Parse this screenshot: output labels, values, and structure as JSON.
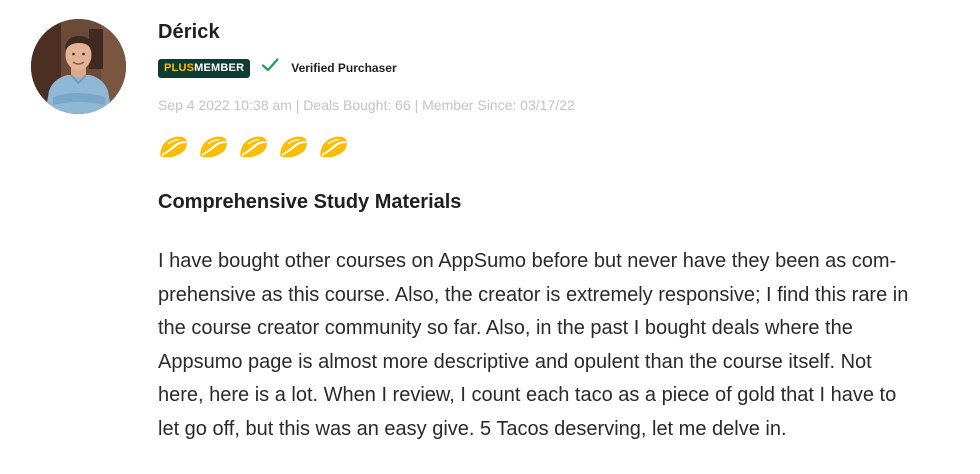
{
  "reviewer": {
    "name": "Dérick",
    "badge_plus": "PLUS",
    "badge_member": "MEMBER",
    "verified_label": "Verified Purchaser",
    "meta": "Sep 4 2022 10:38 am | Deals Bought: 66 | Member Since: 03/17/22",
    "avatar_icon": "person-photo-icon"
  },
  "rating": {
    "value": 5,
    "max": 5,
    "icon": "taco-icon",
    "color": "#ffbc00"
  },
  "review": {
    "title": "Comprehensive Study Materials",
    "body_lines": [
      "I have bought other courses on AppSumo before but never have they been as com-",
      "prehensive as this course. Also, the creator is extremely responsive; I find this rare in",
      "the course creator community so far. Also, in the past I bought deals where the",
      "Appsumo page is almost more descriptive and opulent than the course itself. Not",
      "here, here is a lot. When I review, I count each taco as a piece of gold that I have to",
      "let go off, but this was an easy give. 5 Tacos deserving, let me delve in."
    ]
  },
  "colors": {
    "badge_bg": "#0f3b33",
    "badge_plus": "#ffbc00",
    "check": "#1e9e5a",
    "meta_text": "#c4c4c4"
  }
}
